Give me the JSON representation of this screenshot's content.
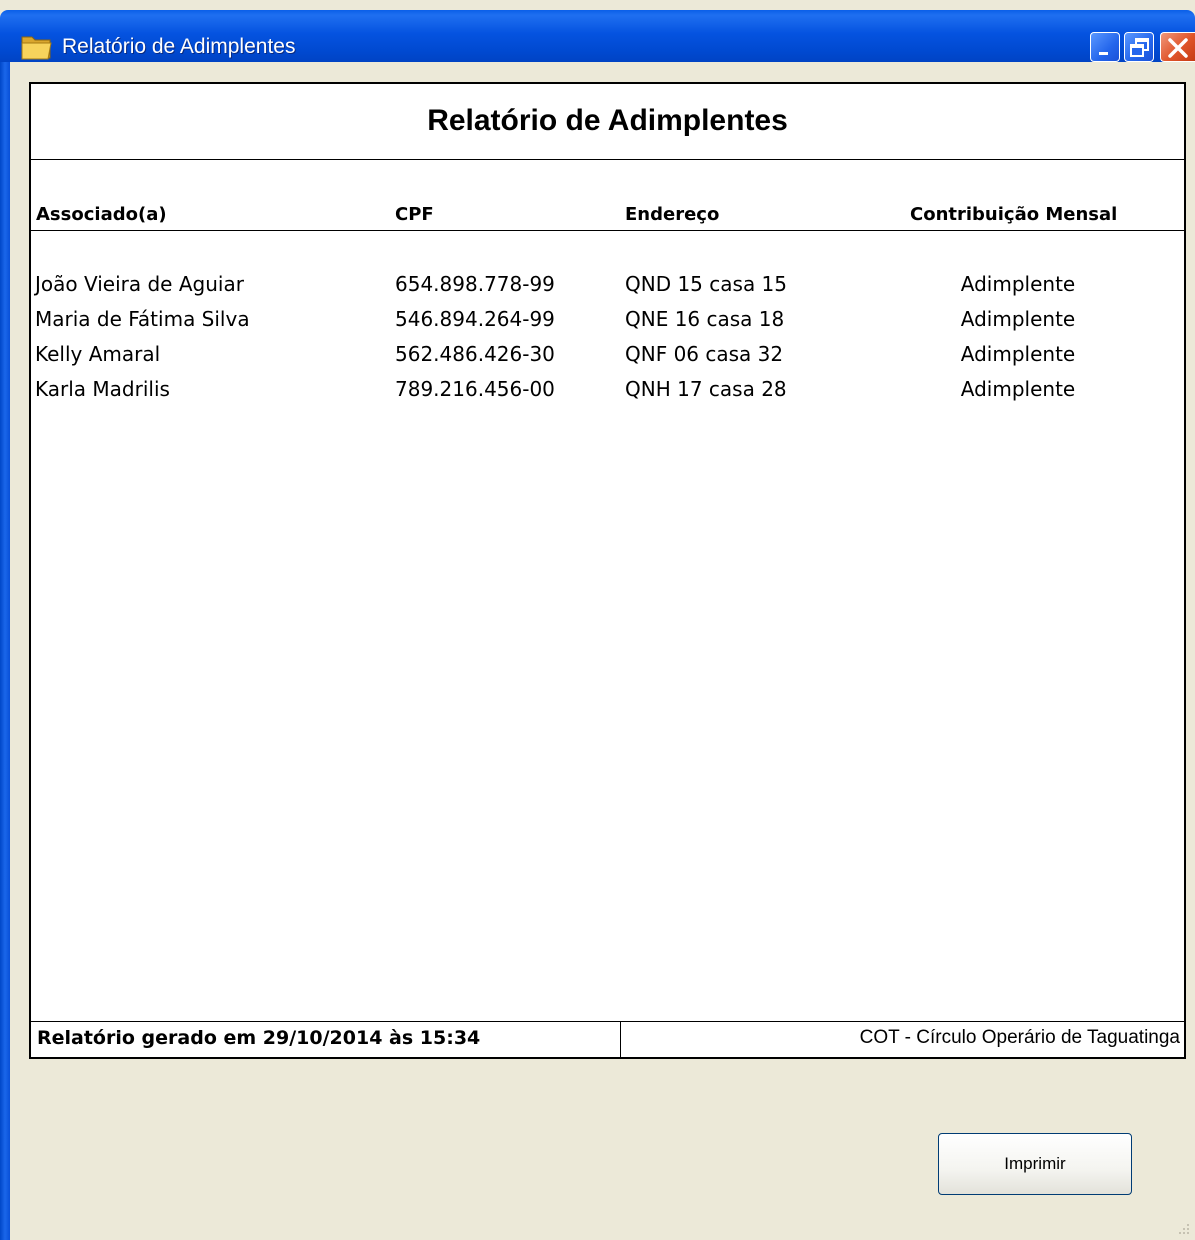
{
  "window": {
    "title": "Relatório de Adimplentes"
  },
  "report": {
    "title": "Relatório de Adimplentes",
    "columns": [
      "Associado(a)",
      "CPF",
      "Endereço",
      "Contribuição Mensal"
    ],
    "rows": [
      {
        "name": "João Vieira de Aguiar",
        "cpf": "654.898.778-99",
        "address": "QND 15 casa 15",
        "status": "Adimplente"
      },
      {
        "name": "Maria de Fátima Silva",
        "cpf": "546.894.264-99",
        "address": "QNE 16 casa 18",
        "status": "Adimplente"
      },
      {
        "name": "Kelly Amaral",
        "cpf": "562.486.426-30",
        "address": "QNF 06 casa 32",
        "status": "Adimplente"
      },
      {
        "name": "Karla Madrilis",
        "cpf": "789.216.456-00",
        "address": "QNH 17 casa 28",
        "status": "Adimplente"
      }
    ],
    "footer_left": "Relatório gerado em 29/10/2014 às 15:34",
    "footer_right": "COT - Círculo Operário de Taguatinga"
  },
  "actions": {
    "print_label": "Imprimir"
  },
  "icons": {
    "window_icon": "folder-icon",
    "minimize": "minimize-icon",
    "restore": "restore-icon",
    "close": "close-icon"
  },
  "colors": {
    "titlebar": "#0553e0",
    "close_button": "#e0552a",
    "window_body": "#ece9d8"
  }
}
